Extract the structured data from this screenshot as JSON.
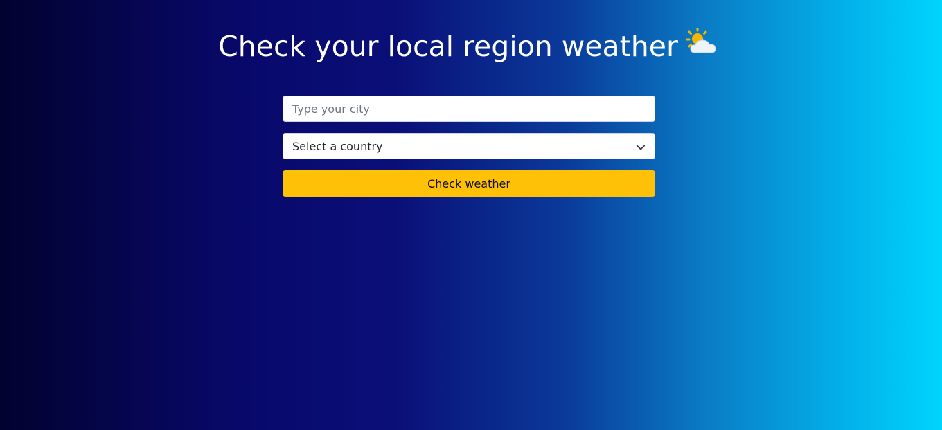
{
  "header": {
    "title": "Check your local region weather",
    "icon": "sun-behind-cloud-icon"
  },
  "form": {
    "city_placeholder": "Type your city",
    "city_value": "",
    "country_selected": "Select a country",
    "submit_label": "Check weather"
  },
  "colors": {
    "button": "#ffc107",
    "gradient_start": "#020230",
    "gradient_end": "#00d4fd"
  }
}
